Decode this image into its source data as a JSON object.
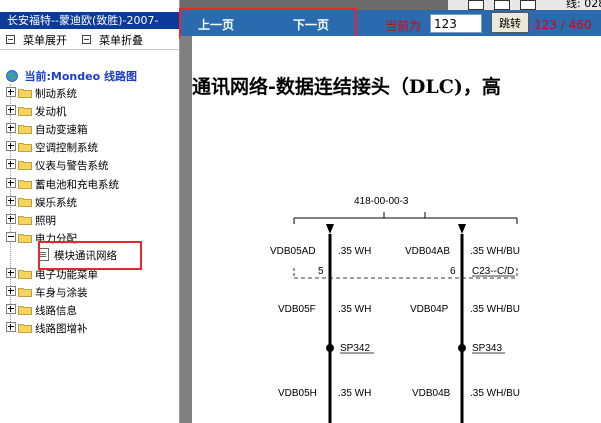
{
  "left_panel": {
    "title": "长安福特--蒙迪欧(致胜)-2007-",
    "toolbar": {
      "expand_label": "菜单展开",
      "collapse_label": "菜单折叠"
    },
    "root_label": "当前:Mondeo 线路图",
    "items": [
      {
        "label": "制动系统",
        "expanded": false
      },
      {
        "label": "发动机",
        "expanded": false
      },
      {
        "label": "自动变速箱",
        "expanded": false
      },
      {
        "label": "空调控制系统",
        "expanded": false
      },
      {
        "label": "仪表与警告系统",
        "expanded": false
      },
      {
        "label": "蓄电池和充电系统",
        "expanded": false
      },
      {
        "label": "娱乐系统",
        "expanded": false
      },
      {
        "label": "照明",
        "expanded": false
      },
      {
        "label": "电力分配",
        "expanded": true
      },
      {
        "label": "电子功能菜单",
        "expanded": false
      },
      {
        "label": "车身与涂装",
        "expanded": false
      },
      {
        "label": "线路信息",
        "expanded": false
      },
      {
        "label": "线路图增补",
        "expanded": false
      }
    ],
    "child_item": {
      "label": "模块通讯网络",
      "selected": true
    }
  },
  "topnav": {
    "prev_label": "上一页",
    "next_label": "下一页",
    "current_label": "当前为",
    "page_value": "123",
    "jump_label": "跳转",
    "page_count": "123 / 460",
    "strip_text": "线: 028"
  },
  "document": {
    "heading": "通讯网络-数据连结接头（DLC)，高",
    "diagram": {
      "header_label": "418-00-00-3",
      "rows": [
        {
          "left_code": "VDB05AD",
          "left_spec": ".35 WH",
          "right_code": "VDB04AB",
          "right_spec": ".35 WH/BU"
        },
        {
          "left_pin": "5",
          "right_pin": "6",
          "connector": "C23--C/D"
        },
        {
          "left_code": "VDB05F",
          "left_spec": ".35 WH",
          "right_code": "VDB04P",
          "right_spec": ".35 WH/BU"
        },
        {
          "left_splice": "SP342",
          "right_splice": "SP343"
        },
        {
          "left_code": "VDB05H",
          "left_spec": ".35 WH",
          "right_code": "VDB04B",
          "right_spec": ".35 WH/BU"
        }
      ]
    }
  },
  "colors": {
    "nav_bar": "#2a6bb0",
    "title_bar": "#0b3a9b",
    "highlight_box": "#e8262e",
    "page_text": "#e00000",
    "root_label": "#1a3ec8"
  }
}
